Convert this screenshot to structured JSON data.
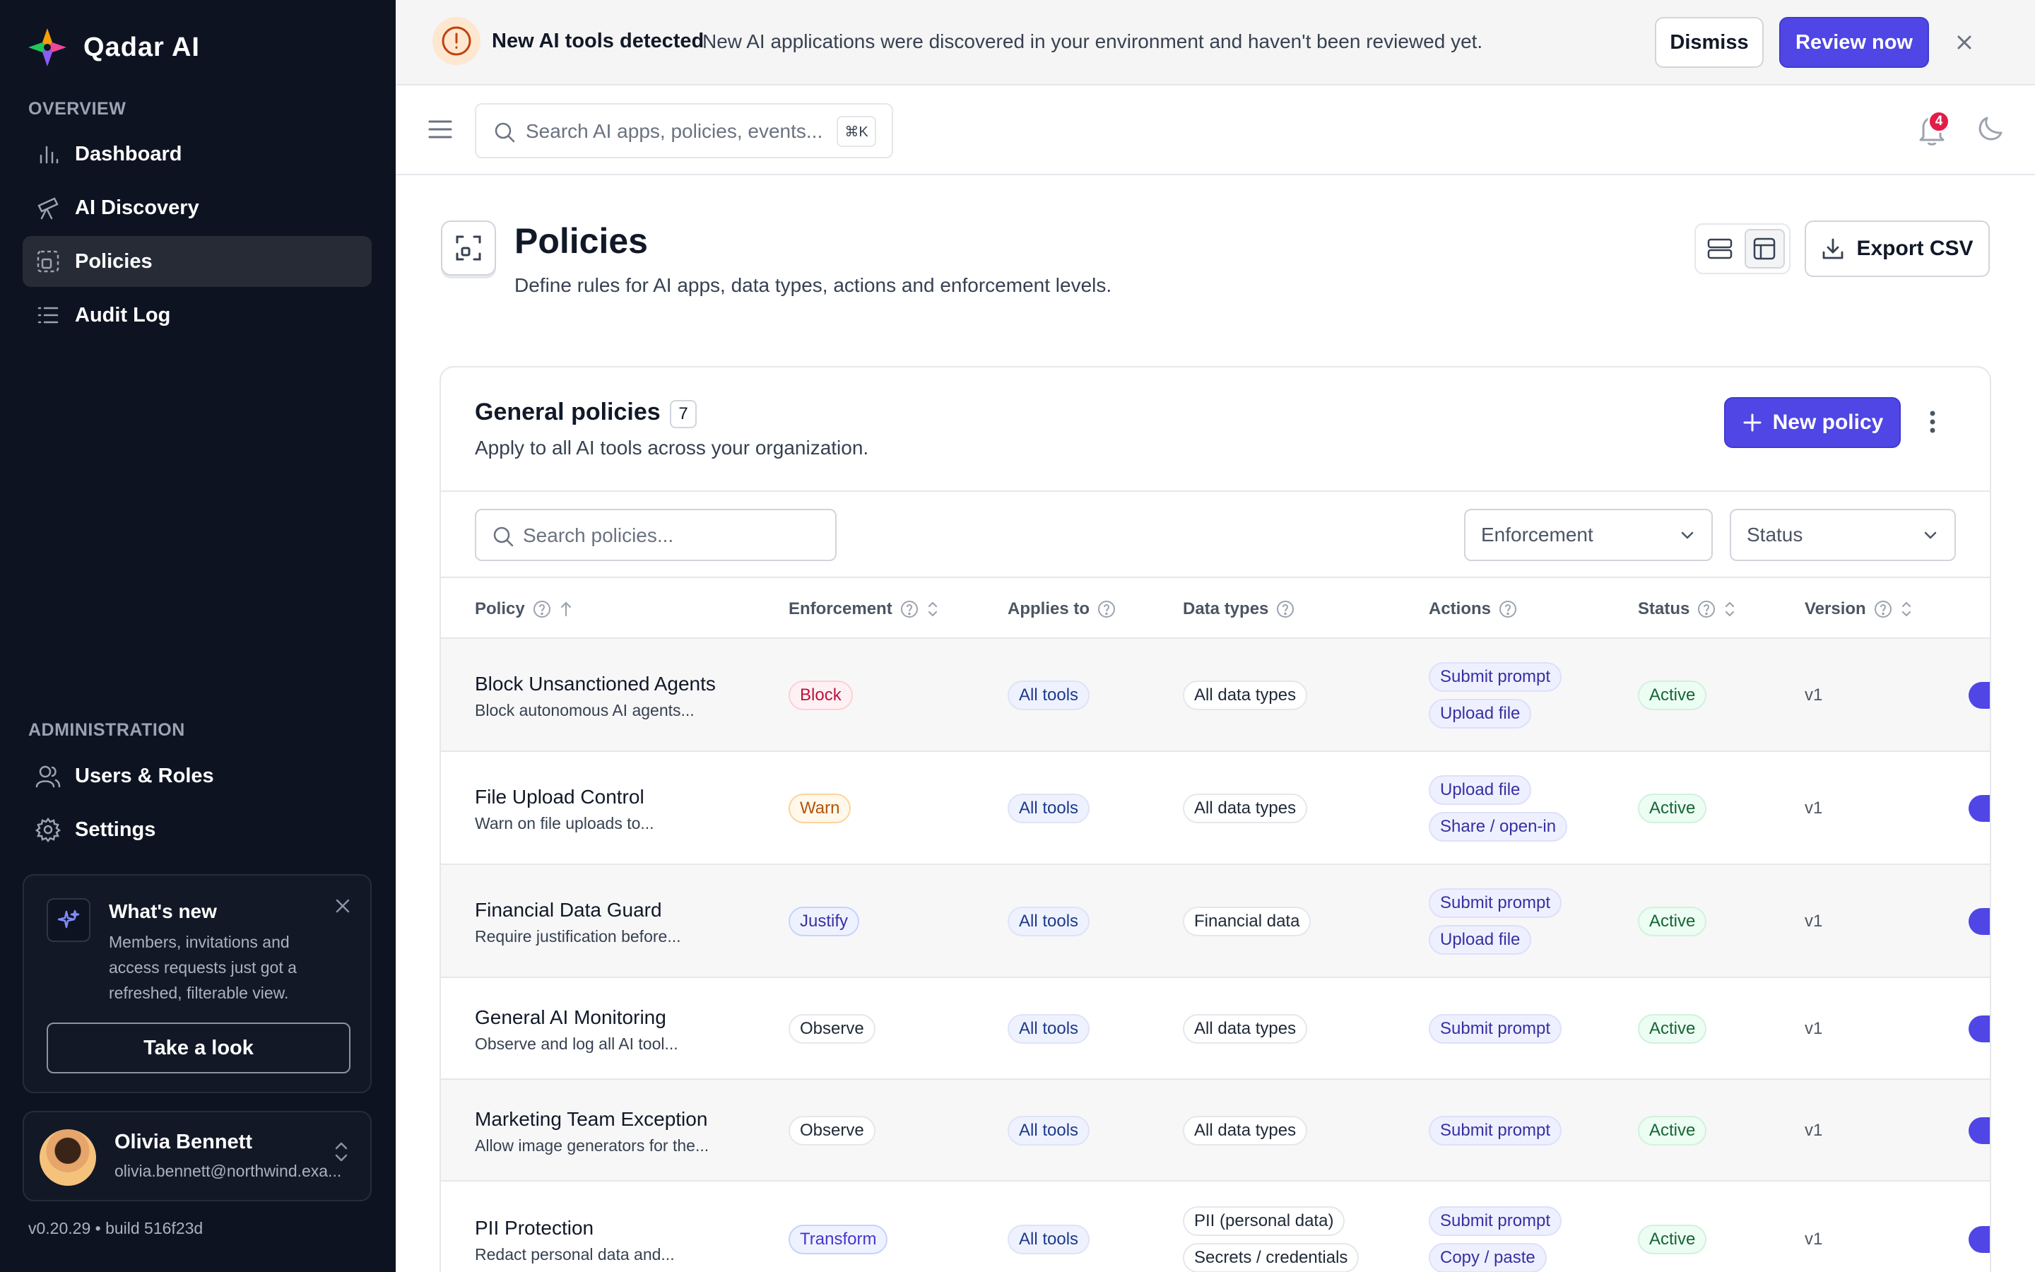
{
  "app": {
    "name": "Qadar AI",
    "version": "v0.20.29 • build 516f23d"
  },
  "sidebar": {
    "overview_label": "OVERVIEW",
    "admin_label": "ADMINISTRATION",
    "items": [
      {
        "label": "Dashboard",
        "icon": "bar-chart-icon",
        "active": false
      },
      {
        "label": "AI Discovery",
        "icon": "telescope-icon",
        "active": false
      },
      {
        "label": "Policies",
        "icon": "policy-icon",
        "active": true
      },
      {
        "label": "Audit Log",
        "icon": "list-icon",
        "active": false
      }
    ],
    "admin_items": [
      {
        "label": "Users & Roles",
        "icon": "users-icon"
      },
      {
        "label": "Settings",
        "icon": "gear-icon"
      }
    ],
    "whats_new": {
      "title": "What's new",
      "text": "Members, invitations and access requests just got a refreshed, filterable view.",
      "button": "Take a look"
    },
    "user": {
      "name": "Olivia Bennett",
      "email": "olivia.bennett@northwind.exa..."
    }
  },
  "banner": {
    "title": "New AI tools detected",
    "text": "New AI applications were discovered in your environment and haven't been reviewed yet.",
    "dismiss": "Dismiss",
    "review": "Review now"
  },
  "topbar": {
    "search_placeholder": "Search AI apps, policies, events...",
    "shortcut": "⌘K",
    "notifications": "4"
  },
  "page": {
    "title": "Policies",
    "subtitle": "Define rules for AI apps, data types, actions and enforcement levels.",
    "export": "Export CSV"
  },
  "card": {
    "title": "General policies",
    "count": "7",
    "subtitle": "Apply to all AI tools across your organization.",
    "new_button": "New policy",
    "search_placeholder": "Search policies...",
    "filter_enforcement": "Enforcement",
    "filter_status": "Status"
  },
  "table": {
    "columns": [
      "Policy",
      "Enforcement",
      "Applies to",
      "Data types",
      "Actions",
      "Status",
      "Version"
    ],
    "rows": [
      {
        "name": "Block Unsanctioned Agents",
        "desc": "Block autonomous AI agents...",
        "enforcement": "Block",
        "applies": "All tools",
        "data_types": [
          "All data types"
        ],
        "actions": [
          "Submit prompt",
          "Upload file"
        ],
        "status": "Active",
        "version": "v1"
      },
      {
        "name": "File Upload Control",
        "desc": "Warn on file uploads to...",
        "enforcement": "Warn",
        "applies": "All tools",
        "data_types": [
          "All data types"
        ],
        "actions": [
          "Upload file",
          "Share / open-in"
        ],
        "status": "Active",
        "version": "v1"
      },
      {
        "name": "Financial Data Guard",
        "desc": "Require justification before...",
        "enforcement": "Justify",
        "applies": "All tools",
        "data_types": [
          "Financial data"
        ],
        "actions": [
          "Submit prompt",
          "Upload file"
        ],
        "status": "Active",
        "version": "v1"
      },
      {
        "name": "General AI Monitoring",
        "desc": "Observe and log all AI tool...",
        "enforcement": "Observe",
        "applies": "All tools",
        "data_types": [
          "All data types"
        ],
        "actions": [
          "Submit prompt"
        ],
        "status": "Active",
        "version": "v1"
      },
      {
        "name": "Marketing Team Exception",
        "desc": "Allow image generators for the...",
        "enforcement": "Observe",
        "applies": "All tools",
        "data_types": [
          "All data types"
        ],
        "actions": [
          "Submit prompt"
        ],
        "status": "Active",
        "version": "v1"
      },
      {
        "name": "PII Protection",
        "desc": "Redact personal data and...",
        "enforcement": "Transform",
        "applies": "All tools",
        "data_types": [
          "PII (personal data)",
          "Secrets / credentials"
        ],
        "actions": [
          "Submit prompt",
          "Copy / paste"
        ],
        "status": "Active",
        "version": "v1"
      }
    ]
  },
  "colors": {
    "accent": "#4f46e5",
    "sidebar_bg": "#0d1321",
    "badge": "#e11d48"
  }
}
